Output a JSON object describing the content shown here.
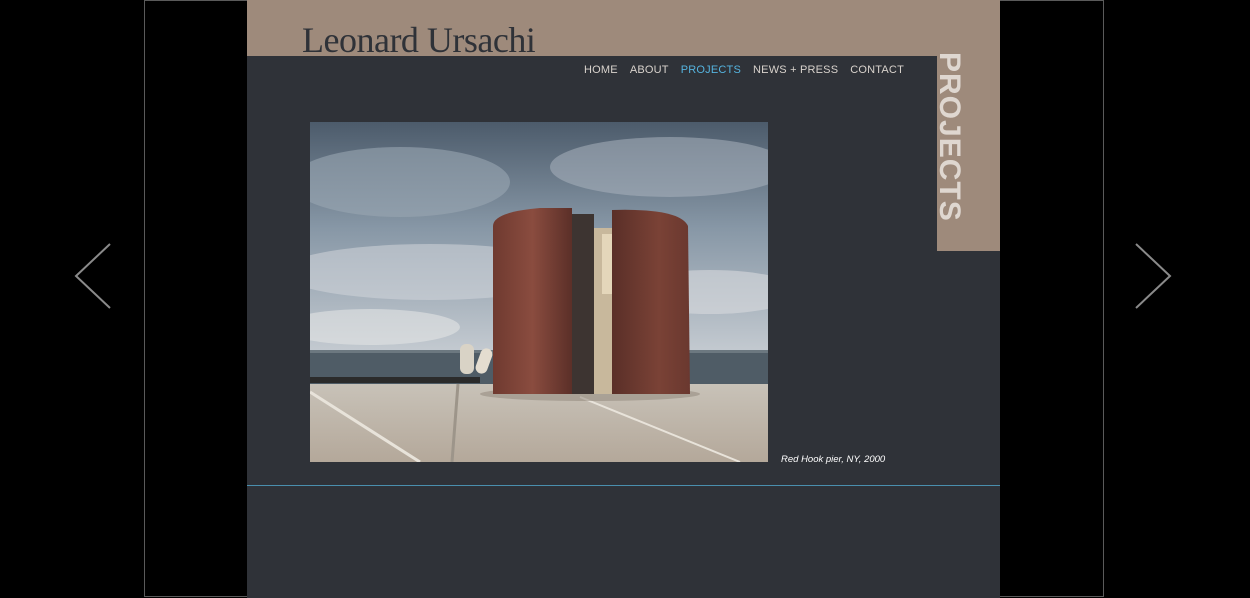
{
  "site": {
    "title": "Leonard Ursachi"
  },
  "nav": {
    "items": [
      {
        "label": "HOME"
      },
      {
        "label": "ABOUT"
      },
      {
        "label": "PROJECTS"
      },
      {
        "label": "NEWS + PRESS"
      },
      {
        "label": "CONTACT"
      }
    ],
    "active_index": 2
  },
  "section": {
    "label": "PROJECTS"
  },
  "slide": {
    "caption": "Red Hook pier, NY, 2000"
  },
  "icons": {
    "prev": "chevron-left-icon",
    "next": "chevron-right-icon"
  },
  "colors": {
    "page_background": "#2f3238",
    "header_band": "#9e8a7b",
    "active_nav": "#55b3de",
    "divider": "#4a8fae"
  }
}
